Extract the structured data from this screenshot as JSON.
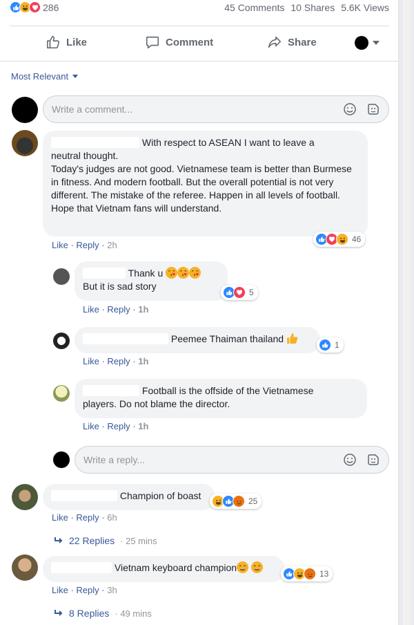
{
  "stats": {
    "reaction_count": "286",
    "comments": "45 Comments",
    "shares": "10 Shares",
    "views": "5.6K Views"
  },
  "actions": {
    "like": "Like",
    "comment": "Comment",
    "share": "Share"
  },
  "sort_label": "Most Relevant",
  "comment_placeholder": "Write a comment...",
  "reply_placeholder": "Write a reply...",
  "comments": [
    {
      "text_first": "With respect to ASEAN I want to leave a",
      "text_rest": "neutral thought.\nToday's judges are not good. Vietnamese team is better than Burmese in fitness. And modern football. But the overall potential is not very different. The mistake of the referee. Happen in all levels of football. Hope that Vietnam fans will understand.",
      "reactions": "46",
      "like": "Like",
      "reply": "Reply",
      "time": "2h"
    },
    {
      "text_first": "Thank u",
      "text_rest": "But it is sad story",
      "reactions": "5",
      "like": "Like",
      "reply": "Reply",
      "time": "1h"
    },
    {
      "text_first": "Peemee Thaiman thailand",
      "reactions": "1",
      "like": "Like",
      "reply": "Reply",
      "time": "1h"
    },
    {
      "text_first": "Football is the offside of the Vietnamese",
      "text_rest": "players. Do not blame the director.",
      "like": "Like",
      "reply": "Reply",
      "time": "1h"
    },
    {
      "text_first": "Champion of boast",
      "reactions": "25",
      "like": "Like",
      "reply": "Reply",
      "time": "6h",
      "replies": "22 Replies",
      "replies_time": "25 mins"
    },
    {
      "text_first": "Vietnam keyboard champion",
      "reactions": "13",
      "like": "Like",
      "reply": "Reply",
      "time": "3h",
      "replies": "8 Replies",
      "replies_time": "49 mins"
    }
  ],
  "colors": {
    "link": "#385898",
    "bubble": "#f2f3f5",
    "like": "#2d88ff",
    "love": "#f33e58",
    "haha": "#f7b125"
  }
}
